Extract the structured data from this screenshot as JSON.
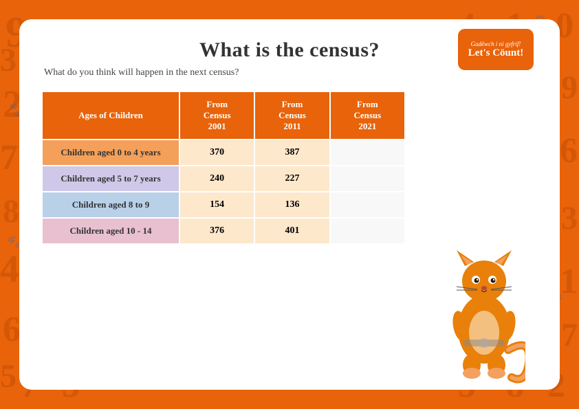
{
  "page": {
    "title": "What is the census?",
    "subtitle": "What do you think will happen in the next census?",
    "background_color": "#e8630a"
  },
  "logo": {
    "line1": "Gadëwch i ni gyfrif!",
    "line2": "Let's Cöunt!"
  },
  "table": {
    "headers": [
      "Ages of Children",
      "From Census 2001",
      "From Census 2011",
      "From Census 2021"
    ],
    "rows": [
      {
        "label": "Children aged 0 to 4 years",
        "col1": "370",
        "col2": "387",
        "col3": "",
        "row_class": "row-orange"
      },
      {
        "label": "Children aged 5 to 7 years",
        "col1": "240",
        "col2": "227",
        "col3": "",
        "row_class": "row-lavender"
      },
      {
        "label": "Children aged 8 to 9",
        "col1": "154",
        "col2": "136",
        "col3": "",
        "row_class": "row-blue"
      },
      {
        "label": "Children aged 10 - 14",
        "col1": "376",
        "col2": "401",
        "col3": "",
        "row_class": "row-pink"
      }
    ]
  },
  "decorations": {
    "numbers": [
      "9",
      "3",
      "2",
      "7",
      "8",
      "4",
      "6",
      "5",
      "2",
      "3",
      "7",
      "9",
      "4",
      "8"
    ]
  }
}
